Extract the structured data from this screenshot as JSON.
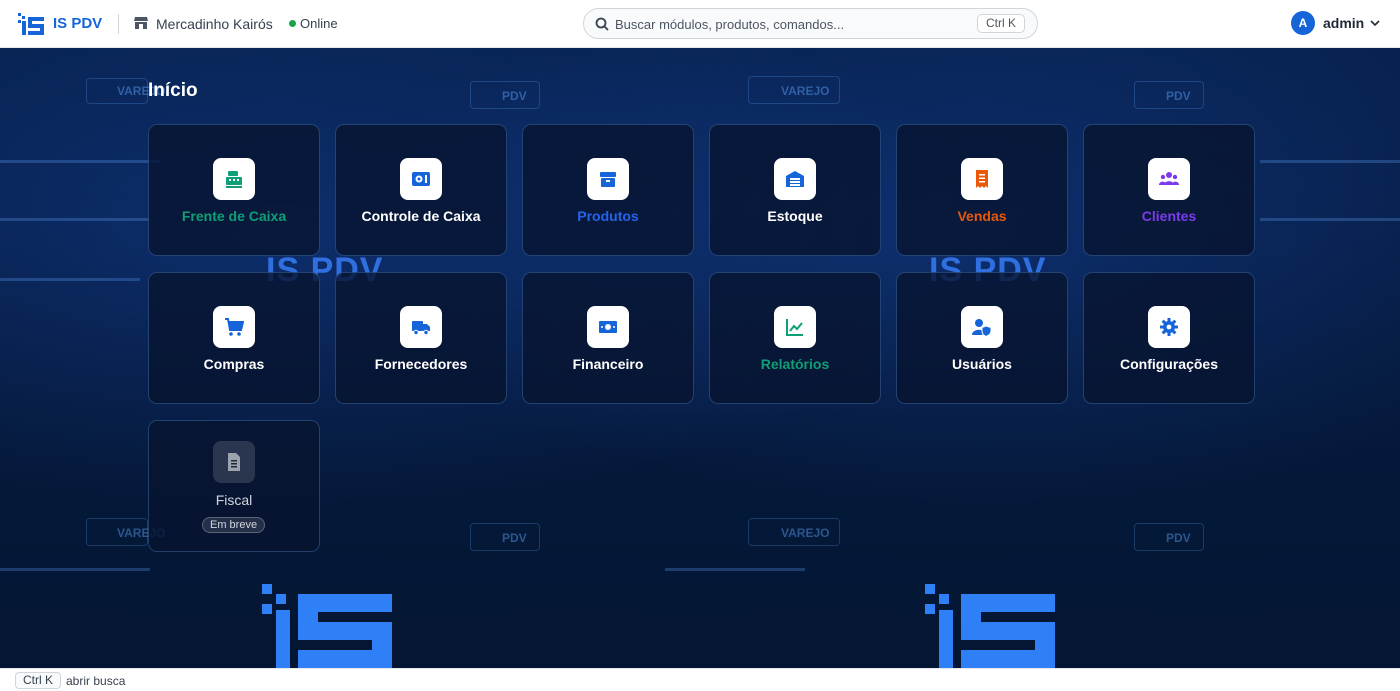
{
  "header": {
    "brand": "IS PDV",
    "store_name": "Mercadinho Kairós",
    "status": "Online",
    "search_placeholder": "Buscar módulos, produtos, comandos...",
    "search_shortcut": "Ctrl K",
    "user_initial": "A",
    "user_name": "admin"
  },
  "background": {
    "watermark_label_a": "VAREJO",
    "watermark_label_b": "PDV",
    "logo_text": "IS PDV"
  },
  "page": {
    "title": "Início"
  },
  "modules": [
    {
      "label": "Frente de Caixa",
      "color": "#0f9f76",
      "icon": "cash-register-icon"
    },
    {
      "label": "Controle de Caixa",
      "color": "#ffffff",
      "icon": "cash-drawer-icon"
    },
    {
      "label": "Produtos",
      "color": "#2563eb",
      "icon": "box-icon"
    },
    {
      "label": "Estoque",
      "color": "#ffffff",
      "icon": "warehouse-icon"
    },
    {
      "label": "Vendas",
      "color": "#ea580c",
      "icon": "receipt-icon"
    },
    {
      "label": "Clientes",
      "color": "#7c3aed",
      "icon": "users-icon"
    },
    {
      "label": "Compras",
      "color": "#ffffff",
      "icon": "cart-icon"
    },
    {
      "label": "Fornecedores",
      "color": "#ffffff",
      "icon": "truck-icon"
    },
    {
      "label": "Financeiro",
      "color": "#ffffff",
      "icon": "money-icon"
    },
    {
      "label": "Relatórios",
      "color": "#0f9f76",
      "icon": "chart-icon"
    },
    {
      "label": "Usuários",
      "color": "#ffffff",
      "icon": "user-shield-icon"
    },
    {
      "label": "Configurações",
      "color": "#ffffff",
      "icon": "gear-icon"
    },
    {
      "label": "Fiscal",
      "color": "#d1d5db",
      "icon": "document-icon",
      "badge": "Em breve"
    }
  ],
  "footer": {
    "shortcut": "Ctrl K",
    "hint": "abrir busca"
  }
}
